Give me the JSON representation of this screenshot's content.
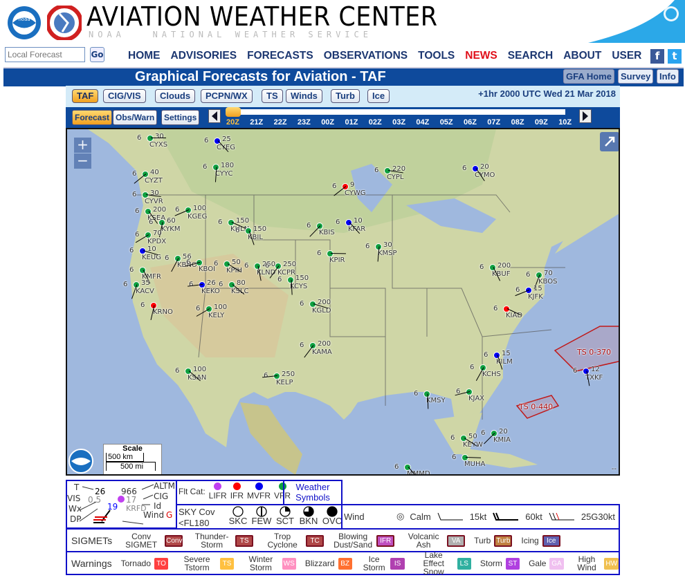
{
  "header": {
    "title": "AVIATION WEATHER CENTER",
    "subtitle": "NOAA   NATIONAL WEATHER SERVICE",
    "logo_left": "NOAA",
    "logo_right": "National Weather Service",
    "colors": {
      "bar": "#0e4a9c",
      "news": "#e0101a"
    }
  },
  "search": {
    "placeholder": "Local Forecast",
    "go": "Go"
  },
  "nav": [
    "HOME",
    "ADVISORIES",
    "FORECASTS",
    "OBSERVATIONS",
    "TOOLS",
    "NEWS",
    "SEARCH",
    "ABOUT",
    "USER"
  ],
  "social": {
    "facebook": "f",
    "twitter": "t"
  },
  "titlebar": {
    "title": "Graphical Forecasts for Aviation - TAF",
    "buttons": [
      "GFA Home",
      "Survey",
      "Info"
    ]
  },
  "tabs": {
    "items": [
      "TAF",
      "CIG/VIS",
      "Clouds",
      "PCPN/WX",
      "TS",
      "Winds",
      "Turb",
      "Ice"
    ],
    "active": "TAF",
    "valid": "+1hr 2000 UTC Wed 21 Mar 2018"
  },
  "controls": {
    "buttons": [
      "Forecast",
      "Obs/Warn",
      "Settings"
    ],
    "active": "Forecast",
    "hours": [
      "20Z",
      "21Z",
      "22Z",
      "23Z",
      "00Z",
      "01Z",
      "02Z",
      "03Z",
      "04Z",
      "05Z",
      "06Z",
      "07Z",
      "08Z",
      "09Z",
      "10Z"
    ],
    "selected_hour": "20Z"
  },
  "map": {
    "zoom_in": "+",
    "zoom_out": "−",
    "scale_title": "Scale",
    "scale_km": "500 km",
    "scale_mi": "500 mi",
    "attribution": "--",
    "sigmets": [
      "TS 0-370",
      "TS 0-440"
    ],
    "stations": [
      {
        "id": "CYXS",
        "cig": "30",
        "vis": "6",
        "cat": "VFR"
      },
      {
        "id": "CYEG",
        "cig": "25",
        "vis": "6",
        "cat": "MVFR"
      },
      {
        "id": "CYYC",
        "cig": "180",
        "vis": "6",
        "cat": "VFR"
      },
      {
        "id": "CYZT",
        "cig": "40",
        "vis": "6",
        "cat": "VFR"
      },
      {
        "id": "CYVR",
        "cig": "30",
        "vis": "6",
        "cat": "VFR"
      },
      {
        "id": "KSEA",
        "cig": "200",
        "vis": "6",
        "cat": "VFR"
      },
      {
        "id": "KYKM",
        "cig": "60",
        "vis": "6",
        "cat": "VFR"
      },
      {
        "id": "KPDX",
        "cig": "70",
        "vis": "6",
        "cat": "VFR"
      },
      {
        "id": "KEUG",
        "cig": "10",
        "vis": "6",
        "cat": "MVFR"
      },
      {
        "id": "KMFR",
        "cig": "",
        "vis": "6",
        "cat": "VFR"
      },
      {
        "id": "KACV",
        "cig": "35",
        "vis": "6",
        "cat": "VFR"
      },
      {
        "id": "KGEG",
        "cig": "100",
        "vis": "6",
        "cat": "VFR"
      },
      {
        "id": "KHLN",
        "cig": "150",
        "vis": "6",
        "cat": "VFR"
      },
      {
        "id": "KBIL",
        "cig": "150",
        "vis": "6",
        "cat": "VFR"
      },
      {
        "id": "KBNO",
        "cig": "56",
        "vis": "6",
        "cat": "VFR"
      },
      {
        "id": "KBOI",
        "cig": "",
        "vis": "6",
        "cat": "VFR"
      },
      {
        "id": "KPIH",
        "cig": "50",
        "vis": "6",
        "cat": "VFR"
      },
      {
        "id": "KLND",
        "cig": "250",
        "vis": "6",
        "cat": "VFR"
      },
      {
        "id": "KCPR",
        "cig": "250",
        "vis": "6",
        "cat": "VFR"
      },
      {
        "id": "KEKO",
        "cig": "26",
        "vis": "6",
        "cat": "MVFR"
      },
      {
        "id": "KSLC",
        "cig": "80",
        "vis": "6",
        "cat": "VFR"
      },
      {
        "id": "KCYS",
        "cig": "150",
        "vis": "6",
        "cat": "VFR"
      },
      {
        "id": "KBIS",
        "cig": "",
        "vis": "6",
        "cat": "VFR"
      },
      {
        "id": "KPIR",
        "cig": "",
        "vis": "6",
        "cat": "VFR"
      },
      {
        "id": "KFAR",
        "cig": "10",
        "vis": "6",
        "cat": "MVFR"
      },
      {
        "id": "KMSP",
        "cig": "30",
        "vis": "6",
        "cat": "VFR"
      },
      {
        "id": "CYWG",
        "cig": "9",
        "vis": "6",
        "cat": "IFR"
      },
      {
        "id": "CYPL",
        "cig": "220",
        "vis": "6",
        "cat": "VFR"
      },
      {
        "id": "CYMO",
        "cig": "20",
        "vis": "6",
        "cat": "MVFR"
      },
      {
        "id": "KRNO",
        "cig": "",
        "vis": "6",
        "cat": "IFR"
      },
      {
        "id": "KELY",
        "cig": "100",
        "vis": "6",
        "cat": "VFR"
      },
      {
        "id": "KGLD",
        "cig": "200",
        "vis": "6",
        "cat": "VFR"
      },
      {
        "id": "KBUF",
        "cig": "200",
        "vis": "6",
        "cat": "VFR"
      },
      {
        "id": "KBOS",
        "cig": "70",
        "vis": "6",
        "cat": "VFR"
      },
      {
        "id": "KJFK",
        "cig": "15",
        "vis": "6",
        "cat": "MVFR"
      },
      {
        "id": "KIAD",
        "cig": "",
        "vis": "6",
        "cat": "IFR"
      },
      {
        "id": "KILM",
        "cig": "15",
        "vis": "6",
        "cat": "MVFR"
      },
      {
        "id": "KCHS",
        "cig": "",
        "vis": "6",
        "cat": "VFR"
      },
      {
        "id": "KJAX",
        "cig": "",
        "vis": "6",
        "cat": "VFR"
      },
      {
        "id": "KEYW",
        "cig": "50",
        "vis": "6",
        "cat": "VFR"
      },
      {
        "id": "TXKF",
        "cig": "12",
        "vis": "6",
        "cat": "MVFR"
      },
      {
        "id": "KAMA",
        "cig": "200",
        "vis": "6",
        "cat": "VFR"
      },
      {
        "id": "KELP",
        "cig": "250",
        "vis": "6",
        "cat": "VFR"
      },
      {
        "id": "KSAN",
        "cig": "100",
        "vis": "6",
        "cat": "VFR"
      },
      {
        "id": "KMSY",
        "cig": "",
        "vis": "6",
        "cat": "VFR"
      },
      {
        "id": "KMIA",
        "cig": "20",
        "vis": "6",
        "cat": "VFR"
      },
      {
        "id": "MUHA",
        "cig": "",
        "vis": "6",
        "cat": "VFR"
      },
      {
        "id": "MMMD",
        "cig": "",
        "vis": "6",
        "cat": "VFR"
      }
    ]
  },
  "legend": {
    "model": {
      "T": "T",
      "VIS": "VIS",
      "Wx": "Wx",
      "DP": "DP",
      "temp": "26",
      "vis": "0.5",
      "dp": "19",
      "altm": "966",
      "cig": "17",
      "id": "KRFD",
      "ALTM": "ALTM",
      "CIG": "CIG",
      "Id": "Id",
      "Wind": "Wind",
      "gust": "G"
    },
    "flt_cat": {
      "label": "Flt Cat:",
      "items": [
        {
          "name": "LIFR",
          "color": "#c040f0"
        },
        {
          "name": "IFR",
          "color": "#ff0000"
        },
        {
          "name": "MVFR",
          "color": "#0000f0"
        },
        {
          "name": "VFR",
          "color": "#10a040"
        }
      ]
    },
    "weather_symbols": "Weather Symbols",
    "sky": {
      "label1": "SKY Cov",
      "label2": "<FL180",
      "items": [
        "SKC",
        "FEW",
        "SCT",
        "BKN",
        "OVC"
      ]
    },
    "wind": {
      "label": "Wind",
      "items": [
        "Calm",
        "15kt",
        "60kt",
        "25G30kt"
      ]
    },
    "sigmets": {
      "label": "SIGMETs",
      "items": [
        {
          "name": "Conv SIGMET",
          "code": "Conv",
          "color": "#b04848"
        },
        {
          "name": "Thunder-Storm",
          "code": "TS",
          "color": "#b04848"
        },
        {
          "name": "Trop Cyclone",
          "code": "TC",
          "color": "#b04848"
        },
        {
          "name": "Blowing Dust/Sand",
          "code": "IFR",
          "color": "#c050c0"
        },
        {
          "name": "Volcanic Ash",
          "code": "VA",
          "color": "#b0b0b0"
        },
        {
          "name": "Turb",
          "code": "Turb",
          "color": "#c08040"
        },
        {
          "name": "Icing",
          "code": "Ice",
          "color": "#6060b0"
        }
      ]
    },
    "warnings": {
      "label": "Warnings",
      "items": [
        {
          "name": "Tornado",
          "code": "TO",
          "color": "#ff4040"
        },
        {
          "name": "Severe Tstorm",
          "code": "TS",
          "color": "#ffc040"
        },
        {
          "name": "Winter Storm",
          "code": "WS",
          "color": "#ff90c0"
        },
        {
          "name": "Blizzard",
          "code": "BZ",
          "color": "#ff7030"
        },
        {
          "name": "Ice Storm",
          "code": "IS",
          "color": "#b040b0"
        },
        {
          "name": "Lake Effect Snow",
          "code": "LS",
          "color": "#30b0a0"
        },
        {
          "name": "Storm",
          "code": "ST",
          "color": "#b040e0"
        },
        {
          "name": "Gale",
          "code": "GA",
          "color": "#f0c0f0"
        },
        {
          "name": "High Wind",
          "code": "HW",
          "color": "#f0c050"
        }
      ]
    }
  }
}
